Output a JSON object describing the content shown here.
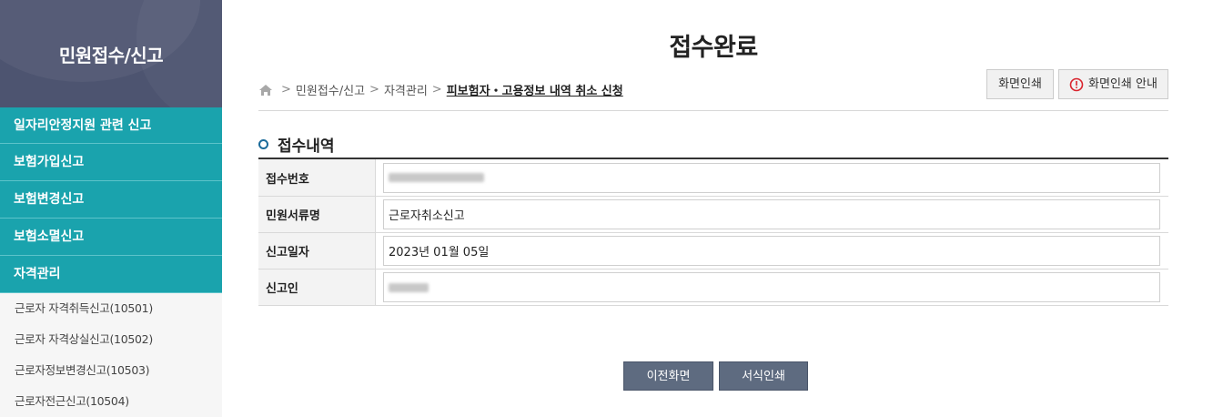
{
  "sidebar": {
    "title": "민원접수/신고",
    "menu": [
      {
        "label": "일자리안정지원 관련 신고"
      },
      {
        "label": "보험가입신고"
      },
      {
        "label": "보험변경신고"
      },
      {
        "label": "보험소멸신고"
      },
      {
        "label": "자격관리"
      }
    ],
    "sub_items": [
      {
        "label": "근로자 자격취득신고(10501)"
      },
      {
        "label": "근로자 자격상실신고(10502)"
      },
      {
        "label": "근로자정보변경신고(10503)"
      },
      {
        "label": "근로자전근신고(10504)"
      }
    ],
    "header_color": "#4d5470",
    "menu_color": "#1aa3ad"
  },
  "page": {
    "title": "접수완료",
    "breadcrumb": [
      "민원접수/신고",
      "자격관리",
      "피보험자・고용정보 내역 취소 신청"
    ],
    "print_button": "화면인쇄",
    "print_guide_button": "화면인쇄 안내"
  },
  "receipt": {
    "section_title": "접수내역",
    "rows": [
      {
        "label": "접수번호",
        "value": ""
      },
      {
        "label": "민원서류명",
        "value": "근로자취소신고"
      },
      {
        "label": "신고일자",
        "value": "2023년 01월 05일"
      },
      {
        "label": "신고인",
        "value": ""
      }
    ]
  },
  "actions": {
    "prev": "이전화면",
    "print_form": "서식인쇄"
  },
  "icons": {
    "home": "home-icon",
    "alert": "alert-circle-icon"
  }
}
